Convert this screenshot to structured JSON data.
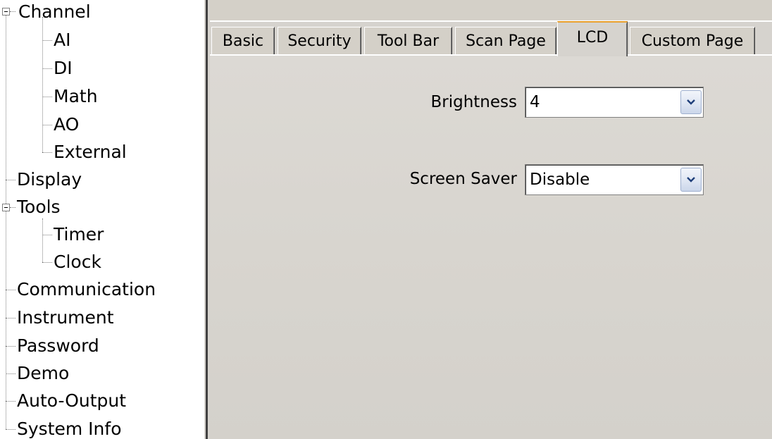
{
  "tree": {
    "items": [
      {
        "label": "Channel",
        "level": 0,
        "expanded": true
      },
      {
        "label": "AI",
        "level": 1
      },
      {
        "label": "DI",
        "level": 1
      },
      {
        "label": "Math",
        "level": 1
      },
      {
        "label": "AO",
        "level": 1
      },
      {
        "label": "External",
        "level": 1
      },
      {
        "label": "Display",
        "level": 0
      },
      {
        "label": "Tools",
        "level": 0,
        "expanded": true
      },
      {
        "label": "Timer",
        "level": 1
      },
      {
        "label": "Clock",
        "level": 1
      },
      {
        "label": "Communication",
        "level": 0
      },
      {
        "label": "Instrument",
        "level": 0
      },
      {
        "label": "Password",
        "level": 0
      },
      {
        "label": "Demo",
        "level": 0
      },
      {
        "label": "Auto-Output",
        "level": 0
      },
      {
        "label": "System Info",
        "level": 0
      }
    ]
  },
  "tabs": [
    {
      "label": "Basic",
      "active": false
    },
    {
      "label": "Security",
      "active": false
    },
    {
      "label": "Tool Bar",
      "active": false
    },
    {
      "label": "Scan Page",
      "active": false
    },
    {
      "label": "LCD",
      "active": true
    },
    {
      "label": "Custom Page",
      "active": false
    }
  ],
  "lcd": {
    "brightness_label": "Brightness",
    "brightness_value": "4",
    "screensaver_label": "Screen Saver",
    "screensaver_value": "Disable"
  },
  "colors": {
    "panel": "#d6d3ce",
    "active_tab_accent": "#e89f2c",
    "dropdown_button": "#dfe6f3"
  }
}
